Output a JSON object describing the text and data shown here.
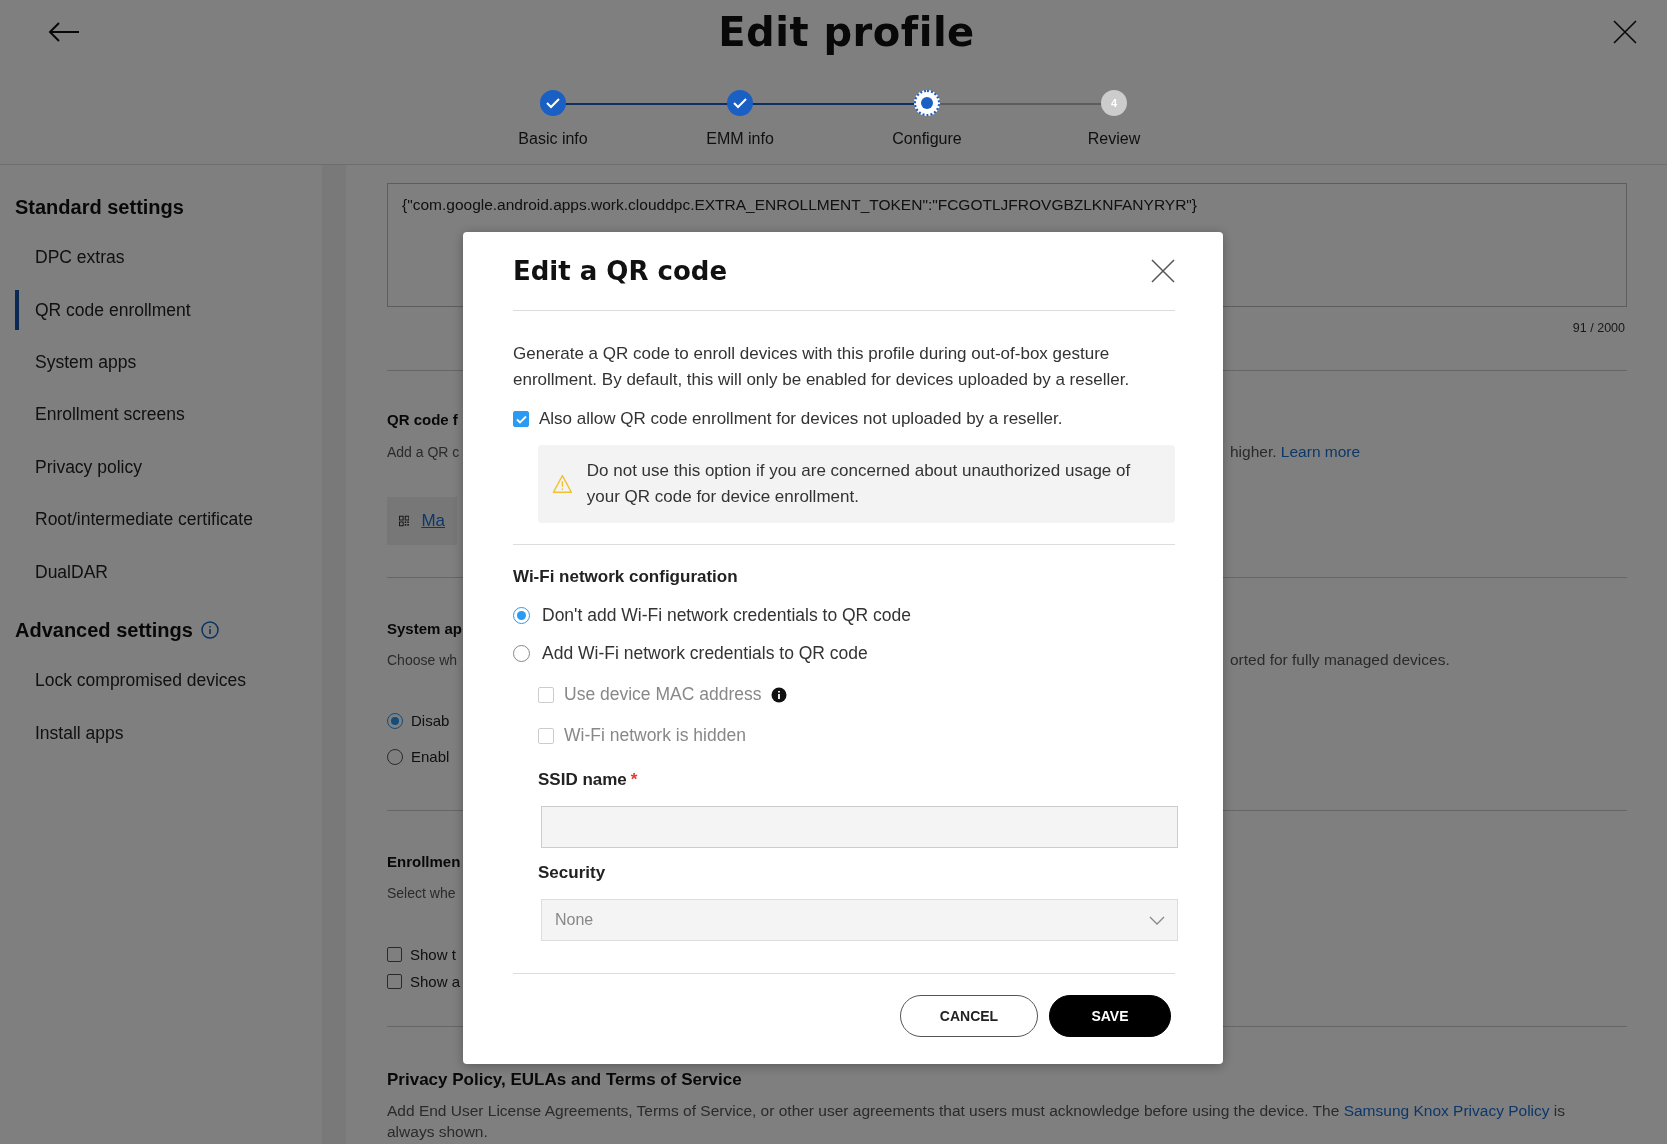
{
  "header": {
    "title": "Edit profile",
    "steps": [
      {
        "label": "Basic info",
        "kind": "done"
      },
      {
        "label": "EMM info",
        "kind": "done"
      },
      {
        "label": "Configure",
        "kind": "current"
      },
      {
        "label": "Review",
        "kind": "pending",
        "number": "4"
      }
    ]
  },
  "sidebar": {
    "sections": [
      {
        "title": "Standard settings",
        "info": false,
        "items": [
          {
            "label": "DPC extras",
            "selected": false
          },
          {
            "label": "QR code enrollment",
            "selected": true
          },
          {
            "label": "System apps",
            "selected": false
          },
          {
            "label": "Enrollment screens",
            "selected": false
          },
          {
            "label": "Privacy policy",
            "selected": false
          },
          {
            "label": "Root/intermediate certificate",
            "selected": false
          },
          {
            "label": "DualDAR",
            "selected": false
          }
        ]
      },
      {
        "title": "Advanced settings",
        "info": true,
        "items": [
          {
            "label": "Lock compromised devices",
            "selected": false
          },
          {
            "label": "Install apps",
            "selected": false
          }
        ]
      }
    ]
  },
  "content": {
    "extras_field": {
      "value": "{\"com.google.android.apps.work.clouddpc.EXTRA_ENROLLMENT_TOKEN\":\"FCGOTLJFROVGBZLKNFANYRYR\"}",
      "counter": "91 / 2000"
    },
    "qr_section": {
      "title": "QR code f",
      "description_left": "Add a QR c",
      "description_right": "higher. ",
      "link": "Learn more",
      "qr_link": "Ma"
    },
    "system_apps": {
      "title": "System ap",
      "description_left": "Choose wh",
      "description_right": "orted for fully managed devices.",
      "options": [
        {
          "label": "Disab",
          "selected": true
        },
        {
          "label": "Enabl",
          "selected": false
        }
      ]
    },
    "enrollment_screens": {
      "title": "Enrollmen",
      "description_left": "Select whe",
      "options": [
        {
          "label": "Show t",
          "checked": false
        },
        {
          "label": "Show a",
          "checked": false
        }
      ]
    },
    "privacy": {
      "title": "Privacy Policy, EULAs and Terms of Service",
      "text": "Add End User License Agreements, Terms of Service, or other user agreements that users must acknowledge before using the device. The ",
      "link": "Samsung Knox Privacy Policy",
      "text_after": " is always shown."
    }
  },
  "dialog": {
    "title": "Edit a QR code",
    "description": "Generate a QR code to enroll devices with this profile during out-of-box gesture enrollment. By default, this will only be enabled for devices uploaded by a reseller.",
    "allow_option": {
      "label": "Also allow QR code enrollment for devices not uploaded by a reseller.",
      "checked": true
    },
    "warning": "Do not use this option if you are concerned about unauthorized usage of your QR code for device enrollment.",
    "wifi": {
      "title": "Wi-Fi network configuration",
      "options": [
        {
          "label": "Don't add Wi-Fi network credentials to QR code",
          "selected": true
        },
        {
          "label": "Add Wi-Fi network credentials to QR code",
          "selected": false
        }
      ],
      "settings": [
        {
          "label": "Use device MAC address",
          "checked": false,
          "disabled": true,
          "info": true
        },
        {
          "label": "Wi-Fi network is hidden",
          "checked": false,
          "disabled": true,
          "info": false
        }
      ],
      "ssid": {
        "label": "SSID name",
        "required_mark": "*"
      },
      "security": {
        "label": "Security",
        "value": "None",
        "disabled": true
      }
    },
    "buttons": [
      {
        "label": "CANCEL",
        "kind": "secondary"
      },
      {
        "label": "SAVE",
        "kind": "primary"
      }
    ]
  }
}
